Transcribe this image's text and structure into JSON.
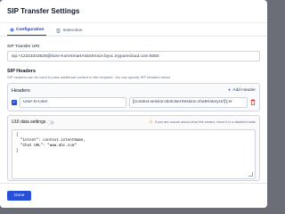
{
  "dialog": {
    "title": "SIP Transfer Settings",
    "tabs": [
      {
        "label": "Configuration",
        "icon": "gear-icon",
        "active": true
      },
      {
        "label": "Instruction",
        "icon": "document-icon",
        "active": false
      }
    ]
  },
  "sip_uri": {
    "label": "SIP Transfer URI",
    "value": "sip:+12223333628@kore-KoreSmartAssistVoice.byoc.mypurecloud.com:5060"
  },
  "sip_headers": {
    "title": "SIP Headers",
    "description": "SIP headers can be used to pass additional context to the recipient. You can specify SIP headers below",
    "headers_box": {
      "title": "Headers",
      "add_label": "Add Header",
      "rows": [
        {
          "key": "User-to-User",
          "value": "{{context.session.BotUserSession.chatHistoryUrl}};er",
          "checked": true
        }
      ]
    }
  },
  "uui": {
    "title": "UUI data settings",
    "note": "If you are unsure about what this means, leave it in a disabled state",
    "code_lines": [
      "{",
      "  \"intent\": context.intentName,",
      "  \"Chat URL\": \"www.abc.com\"",
      "}"
    ]
  },
  "footer": {
    "done_label": "Done"
  },
  "colors": {
    "accent": "#2650d8",
    "overlay": "#6b6e77",
    "warning": "#f79009",
    "danger": "#d92d20"
  }
}
